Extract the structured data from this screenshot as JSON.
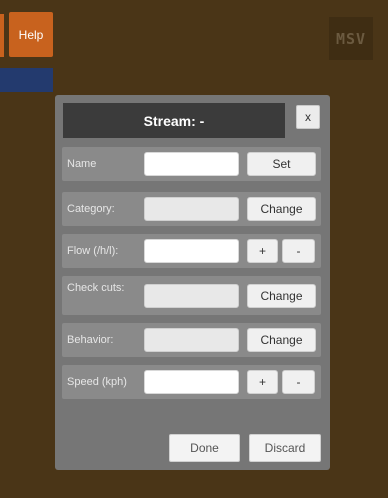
{
  "toolbar": {
    "help_label": "Help"
  },
  "logo": {
    "text": "MSV"
  },
  "dialog": {
    "title": "Stream: -",
    "close_label": "x",
    "rows": [
      {
        "label": "Name",
        "value": "",
        "button": "Set"
      },
      {
        "label": "Category:",
        "value": "",
        "button": "Change"
      },
      {
        "label": "Flow (/h/l):",
        "value": "",
        "plus": "+",
        "minus": "-"
      },
      {
        "label": "Check cuts:",
        "value": "",
        "button": "Change"
      },
      {
        "label": "Behavior:",
        "value": "",
        "button": "Change"
      },
      {
        "label": "Speed (kph)",
        "value": "",
        "plus": "+",
        "minus": "-"
      }
    ],
    "done_label": "Done",
    "discard_label": "Discard"
  },
  "colors": {
    "background": "#4a3517",
    "accent_orange": "#c8621e",
    "accent_blue": "#233a6e",
    "dialog_bg": "#767676",
    "title_bar": "#3b3b3b",
    "row_bg": "#8a8a8a"
  }
}
